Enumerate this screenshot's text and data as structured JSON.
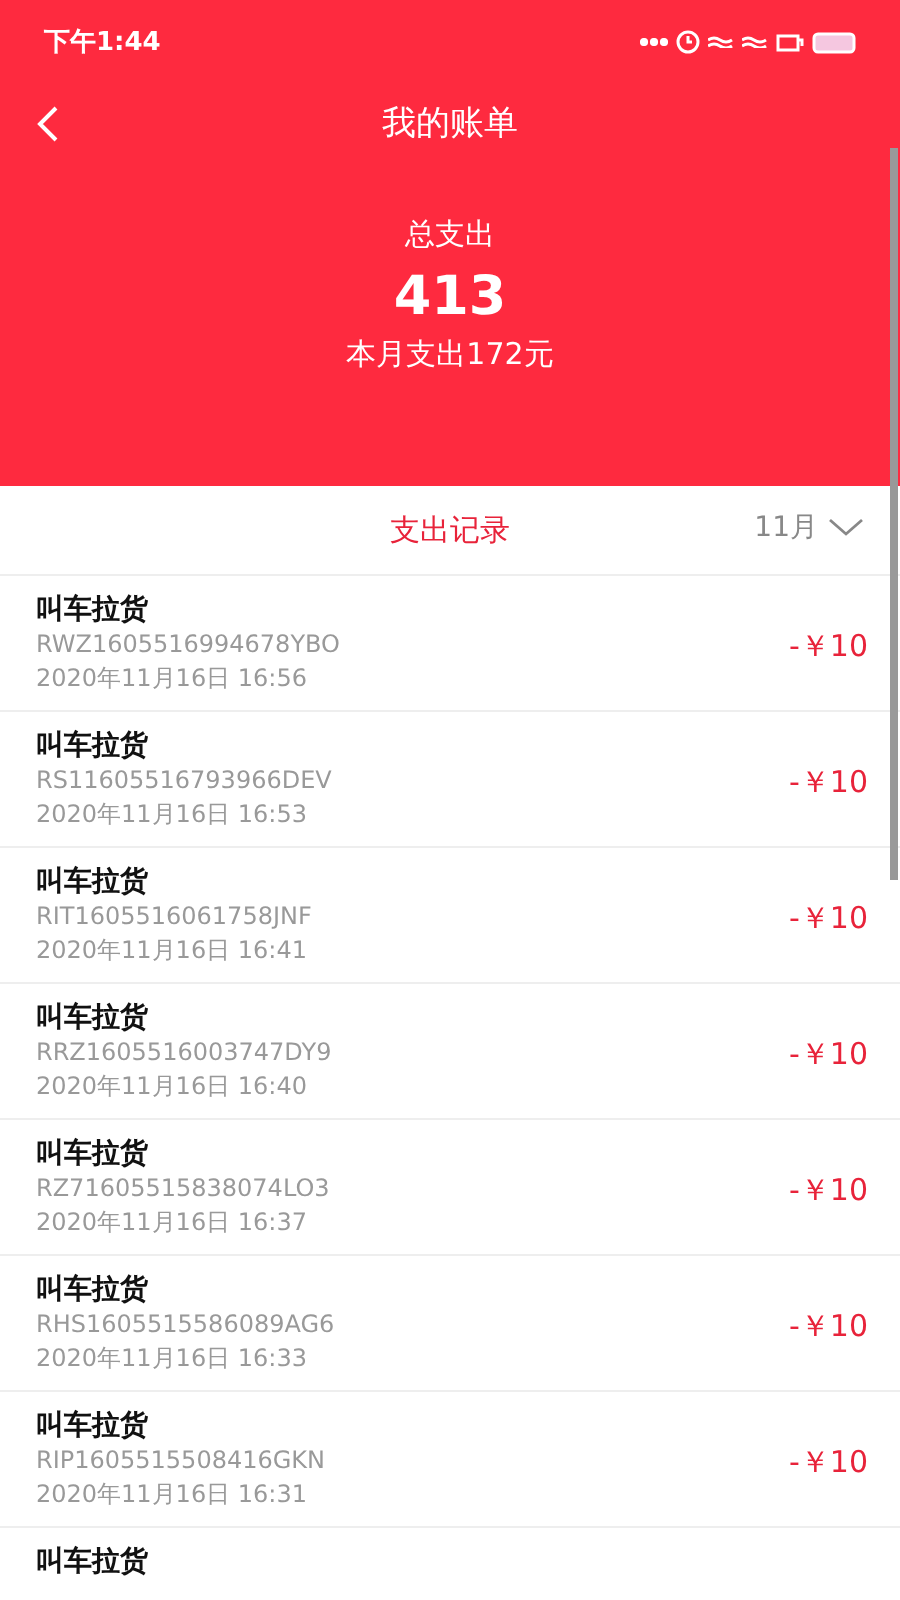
{
  "status_bar": {
    "time": "下午1:44"
  },
  "header": {
    "title": "我的账单",
    "total_label": "总支出",
    "total": "413",
    "month_summary": "本月支出172元"
  },
  "section": {
    "title": "支出记录",
    "month": "11月"
  },
  "records": [
    {
      "title": "叫车拉货",
      "order": "RWZ1605516994678YBO",
      "time": "2020年11月16日 16:56",
      "amount": "-￥10"
    },
    {
      "title": "叫车拉货",
      "order": "RS11605516793966DEV",
      "time": "2020年11月16日 16:53",
      "amount": "-￥10"
    },
    {
      "title": "叫车拉货",
      "order": "RIT1605516061758JNF",
      "time": "2020年11月16日 16:41",
      "amount": "-￥10"
    },
    {
      "title": "叫车拉货",
      "order": "RRZ1605516003747DY9",
      "time": "2020年11月16日 16:40",
      "amount": "-￥10"
    },
    {
      "title": "叫车拉货",
      "order": "RZ71605515838074LO3",
      "time": "2020年11月16日 16:37",
      "amount": "-￥10"
    },
    {
      "title": "叫车拉货",
      "order": "RHS1605515586089AG6",
      "time": "2020年11月16日 16:33",
      "amount": "-￥10"
    },
    {
      "title": "叫车拉货",
      "order": "RIP1605515508416GKN",
      "time": "2020年11月16日 16:31",
      "amount": "-￥10"
    },
    {
      "title": "叫车拉货"
    }
  ]
}
